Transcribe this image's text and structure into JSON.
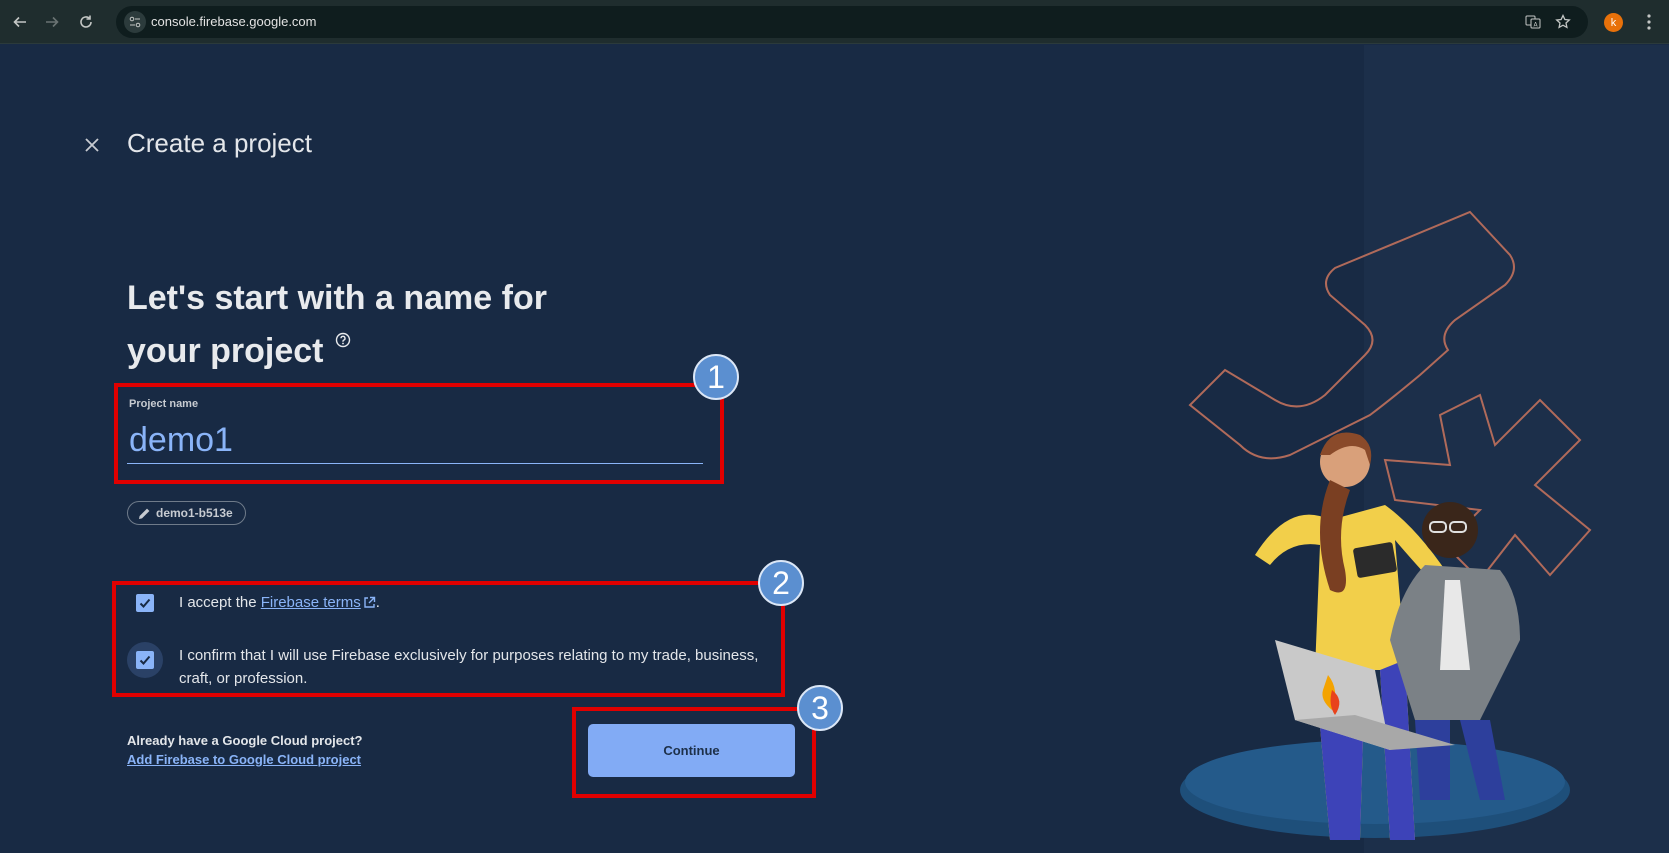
{
  "browser": {
    "url": "console.firebase.google.com",
    "avatar_letter": "k"
  },
  "page": {
    "title": "Create a project",
    "headline_line1": "Let's start with a name for",
    "headline_line2": "your project"
  },
  "project_name": {
    "label": "Project name",
    "value": "demo1",
    "project_id": "demo1-b513e"
  },
  "terms": {
    "accept_prefix": "I accept the ",
    "accept_link": "Firebase terms",
    "accept_suffix": ".",
    "accept_checked": true,
    "confirm_text": "I confirm that I will use Firebase exclusively for purposes relating to my trade, business, craft, or profession.",
    "confirm_checked": true
  },
  "footer": {
    "question": "Already have a Google Cloud project?",
    "link": "Add Firebase to Google Cloud project",
    "continue_label": "Continue"
  },
  "annotations": {
    "badge1": "1",
    "badge2": "2",
    "badge3": "3"
  },
  "colors": {
    "background": "#182a44",
    "accent": "#8ab4f8",
    "highlight": "#e00000"
  }
}
